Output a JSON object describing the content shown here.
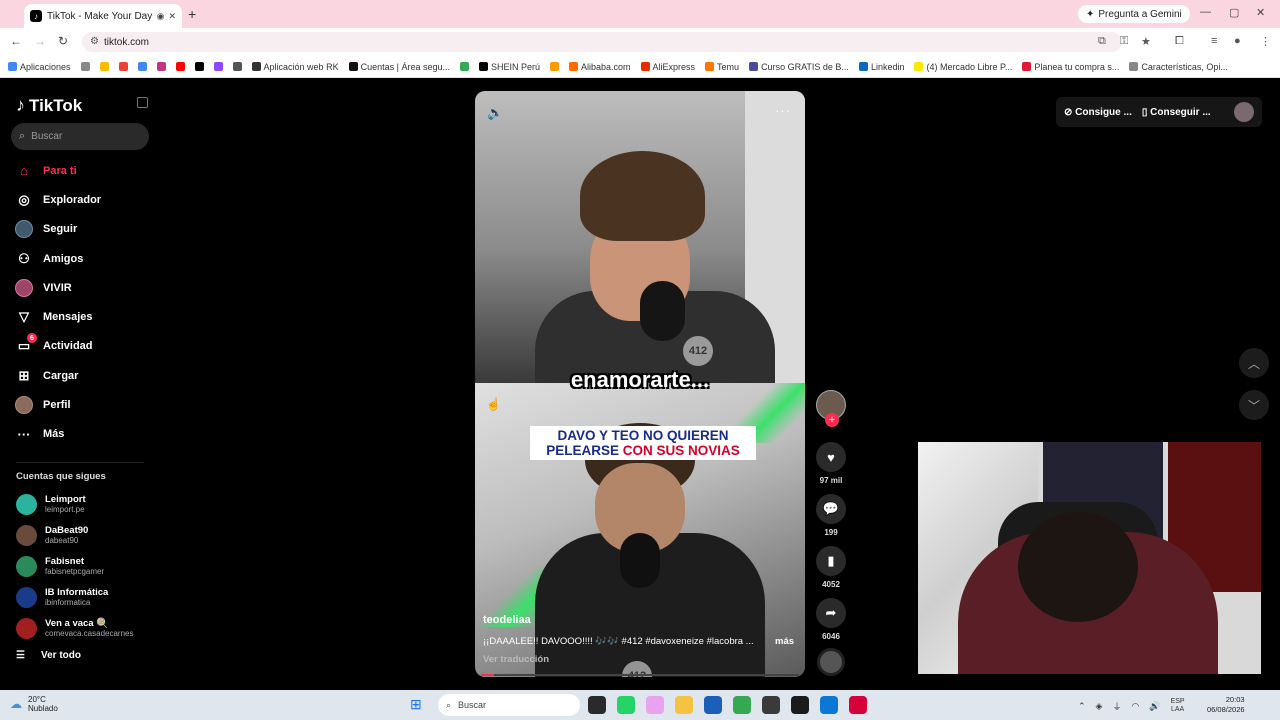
{
  "browser": {
    "tab_title": "TikTok - Make Your Day",
    "new_tab": "+",
    "gemini": "Pregunta a Gemini",
    "url": "tiktok.com",
    "bookmarks": [
      {
        "label": "Aplicaciones",
        "color": "#4285f4"
      },
      {
        "label": "",
        "color": "#888888"
      },
      {
        "label": "",
        "color": "#fbbc05"
      },
      {
        "label": "",
        "color": "#ea4335"
      },
      {
        "label": "",
        "color": "#4285f4"
      },
      {
        "label": "",
        "color": "#c13584"
      },
      {
        "label": "",
        "color": "#ff0000"
      },
      {
        "label": "",
        "color": "#000000"
      },
      {
        "label": "",
        "color": "#9146ff"
      },
      {
        "label": "",
        "color": "#555555"
      },
      {
        "label": "Aplicación web RK",
        "color": "#333333"
      },
      {
        "label": "Cuentas | Área segu...",
        "color": "#111111"
      },
      {
        "label": "",
        "color": "#34a853"
      },
      {
        "label": "SHEIN Perú",
        "color": "#000000"
      },
      {
        "label": "",
        "color": "#ff9900"
      },
      {
        "label": "Alibaba.com",
        "color": "#ff6a00"
      },
      {
        "label": "AliExpress",
        "color": "#e62e04"
      },
      {
        "label": "Temu",
        "color": "#fb7701"
      },
      {
        "label": "Curso GRATIS de B...",
        "color": "#4a4aa0"
      },
      {
        "label": "Linkedin",
        "color": "#0a66c2"
      },
      {
        "label": "(4) Mercado Libre P...",
        "color": "#ffe600"
      },
      {
        "label": "Planea tu compra s...",
        "color": "#e31837"
      },
      {
        "label": "Características, Opi...",
        "color": "#888888"
      }
    ]
  },
  "sidebar": {
    "brand": "TikTok",
    "search_placeholder": "Buscar",
    "nav": [
      {
        "label": "Para ti",
        "icon": "home-icon"
      },
      {
        "label": "Explorador",
        "icon": "compass-icon"
      },
      {
        "label": "Seguir",
        "icon": "following-icon"
      },
      {
        "label": "Amigos",
        "icon": "friends-icon"
      },
      {
        "label": "VIVIR",
        "icon": "live-icon"
      },
      {
        "label": "Mensajes",
        "icon": "messages-icon"
      },
      {
        "label": "Actividad",
        "icon": "activity-icon",
        "badge": "6"
      },
      {
        "label": "Cargar",
        "icon": "upload-icon"
      },
      {
        "label": "Perfil",
        "icon": "profile-icon"
      },
      {
        "label": "Más",
        "icon": "more-icon"
      }
    ],
    "follows_title": "Cuentas que sigues",
    "follows": [
      {
        "name": "Leimport",
        "handle": "leimport.pe",
        "color": "#2bb3a0"
      },
      {
        "name": "DaBeat90",
        "handle": "dabeat90",
        "color": "#6a4a3a"
      },
      {
        "name": "Fabisnet",
        "handle": "fabisnetpcgamer",
        "color": "#2a8a5a"
      },
      {
        "name": "IB Informática",
        "handle": "ibinformatica",
        "color": "#1a3a8a"
      },
      {
        "name": "Ven a vaca 🍭",
        "handle": "comevaca.casadecarnes",
        "color": "#a02020"
      }
    ],
    "see_all": "Ver todo"
  },
  "video": {
    "caption": "enamorarte...",
    "headline_l1": "DAVO Y TEO NO QUIEREN",
    "headline_l2a": "PELEARSE",
    "headline_l2b": "CON SUS NOVIAS",
    "logo": "412",
    "author": "teodeliaa",
    "description": "¡¡DAAALEE!! DAVOOO!!!! 🎶🎶 #412 #davoxeneize #lacobra ...",
    "more": "más",
    "translate": "Ver traducción",
    "progress": 0.04
  },
  "actions": {
    "likes": "97 mil",
    "comments": "199",
    "saves": "4052",
    "shares": "6046"
  },
  "topright": {
    "btn1": "Consigue ...",
    "btn2": "Conseguir ..."
  },
  "taskbar": {
    "temp": "20°C",
    "weather": "Nublado",
    "search": "Buscar",
    "lang1": "ESP",
    "lang2": "LAA",
    "time": "20:03",
    "date": "06/08/2026",
    "apps": [
      "#2a2a2a",
      "#25d366",
      "#e8a2f0",
      "#f5c242",
      "#1b5fb8",
      "#34a853",
      "#3a3a3a",
      "#1b1b1b",
      "#0a78d4",
      "#d6003a"
    ]
  }
}
